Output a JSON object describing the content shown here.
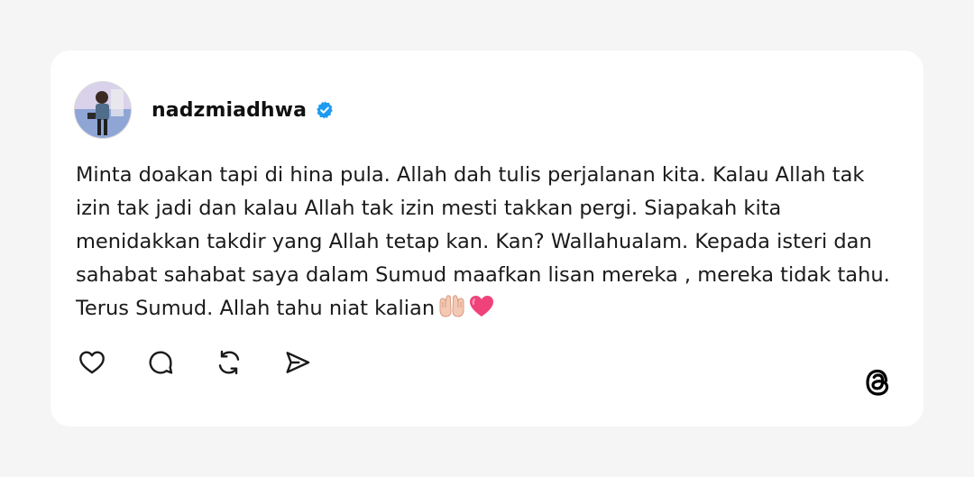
{
  "post": {
    "author": {
      "username": "nadzmiadhwa",
      "verified": true,
      "verified_badge_color": "#1d9bf0"
    },
    "text": "Minta doakan tapi di hina pula. Allah dah tulis perjalanan kita. Kalau Allah tak izin tak jadi dan kalau Allah tak izin mesti takkan pergi. Siapakah kita menidakkan takdir yang Allah tetap kan. Kan? Wallahualam. Kepada isteri dan sahabat sahabat saya dalam Sumud maafkan lisan mereka , mereka tidak tahu. Terus Sumud. Allah tahu niat kalian",
    "emojis": [
      "palms-up-together",
      "pink-heart"
    ]
  },
  "actions": {
    "like_icon": "heart-icon",
    "reply_icon": "comment-icon",
    "repost_icon": "repost-icon",
    "share_icon": "send-icon"
  },
  "brand": {
    "logo": "threads-logo"
  }
}
